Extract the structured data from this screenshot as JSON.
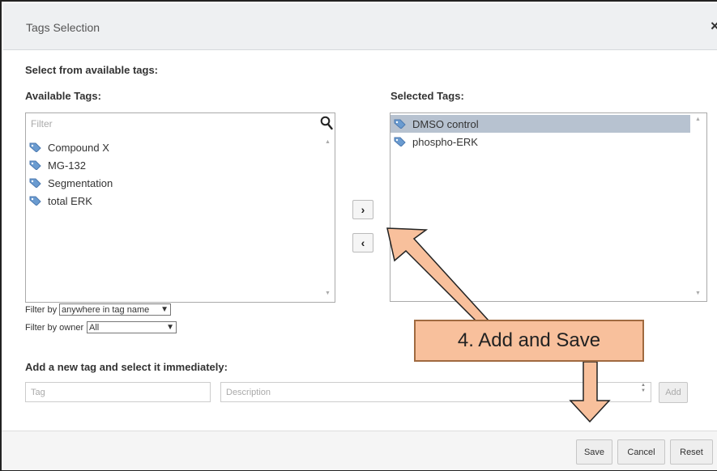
{
  "dialog": {
    "title": "Tags Selection",
    "close_glyph": "×"
  },
  "instructions": "Select from available tags:",
  "available": {
    "label": "Available Tags:",
    "filter_placeholder": "Filter",
    "items": [
      {
        "label": "Compound X"
      },
      {
        "label": "MG-132"
      },
      {
        "label": "Segmentation"
      },
      {
        "label": "total ERK"
      }
    ]
  },
  "selected": {
    "label": "Selected Tags:",
    "items": [
      {
        "label": "DMSO control",
        "highlighted": true
      },
      {
        "label": "phospho-ERK",
        "highlighted": false
      }
    ]
  },
  "move": {
    "add_glyph": "›",
    "remove_glyph": "‹"
  },
  "filter_by": {
    "label": "Filter by",
    "value": "anywhere in tag name"
  },
  "filter_owner": {
    "label": "Filter by owner",
    "value": "All"
  },
  "new_tag": {
    "label": "Add a new tag and select it immediately:",
    "tag_placeholder": "Tag",
    "description_placeholder": "Description",
    "add_label": "Add"
  },
  "footer": {
    "save": "Save",
    "cancel": "Cancel",
    "reset": "Reset"
  },
  "annotation": {
    "text": "4. Add and Save",
    "color": "#f8c09c",
    "border": "#a06a40"
  },
  "colors": {
    "tag_icon": "#6a9bd0",
    "highlight": "#b7c2d0"
  },
  "icons": {
    "search": "search-icon",
    "tag": "tag-icon",
    "arrow": "arrow-icon"
  }
}
